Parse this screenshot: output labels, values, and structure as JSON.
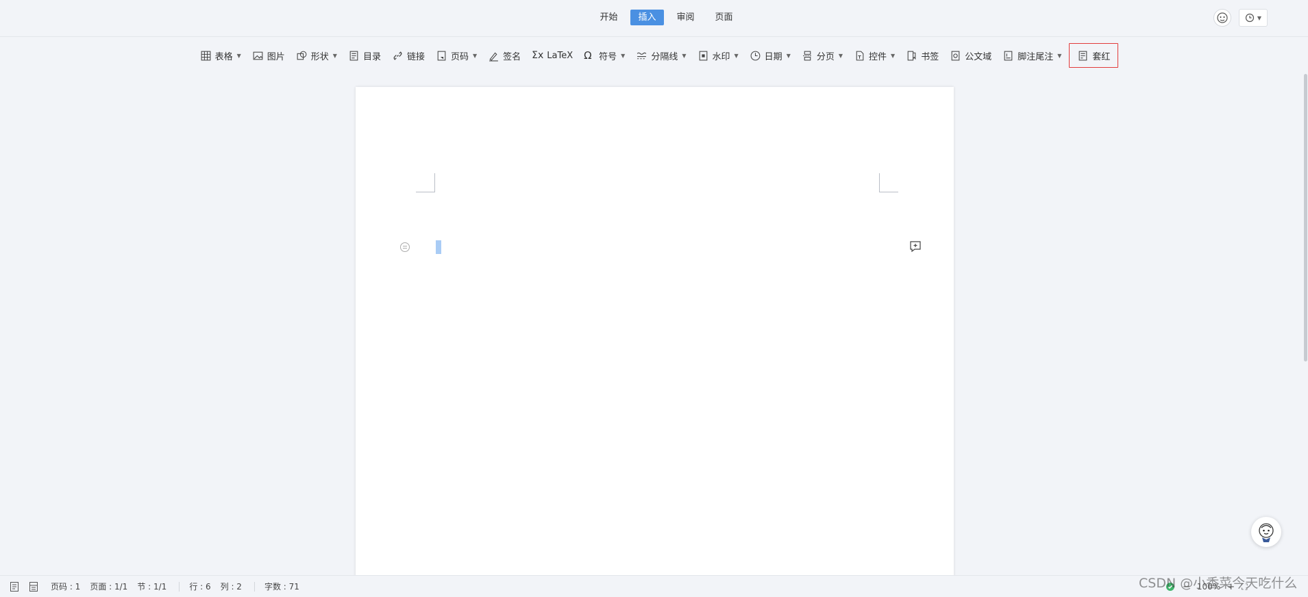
{
  "tabs": [
    {
      "label": "开始",
      "active": false
    },
    {
      "label": "插入",
      "active": true
    },
    {
      "label": "审阅",
      "active": false
    },
    {
      "label": "页面",
      "active": false
    }
  ],
  "colors": {
    "accent": "#4a90e2",
    "highlight_border": "#e23a3a",
    "selection": "#a9ccf5"
  },
  "ribbon": [
    {
      "label": "表格",
      "icon": "table-icon",
      "dropdown": true
    },
    {
      "label": "图片",
      "icon": "image-icon",
      "dropdown": false
    },
    {
      "label": "形状",
      "icon": "shape-icon",
      "dropdown": true
    },
    {
      "label": "目录",
      "icon": "toc-icon",
      "dropdown": false
    },
    {
      "label": "链接",
      "icon": "link-icon",
      "dropdown": false
    },
    {
      "label": "页码",
      "icon": "page-number-icon",
      "dropdown": true
    },
    {
      "label": "签名",
      "icon": "signature-icon",
      "dropdown": false
    },
    {
      "label": "LaTeX",
      "icon": "sigma-icon",
      "dropdown": false
    },
    {
      "label": "符号",
      "icon": "omega-icon",
      "dropdown": true
    },
    {
      "label": "分隔线",
      "icon": "divider-icon",
      "dropdown": true
    },
    {
      "label": "水印",
      "icon": "watermark-icon",
      "dropdown": true
    },
    {
      "label": "日期",
      "icon": "clock-icon",
      "dropdown": true
    },
    {
      "label": "分页",
      "icon": "page-break-icon",
      "dropdown": true
    },
    {
      "label": "控件",
      "icon": "control-icon",
      "dropdown": true
    },
    {
      "label": "书签",
      "icon": "bookmark-icon",
      "dropdown": false
    },
    {
      "label": "公文域",
      "icon": "official-field-icon",
      "dropdown": false
    },
    {
      "label": "脚注尾注",
      "icon": "footnote-icon",
      "dropdown": true
    },
    {
      "label": "套红",
      "icon": "red-header-icon",
      "dropdown": false,
      "highlighted": true
    }
  ],
  "status": {
    "page_code": "页码 : 1",
    "page": "页面 : 1/1",
    "section": "节 : 1/1",
    "row": "行 : 6",
    "col": "列 : 2",
    "word_count": "字数 : 71",
    "zoom": "100%"
  },
  "watermark": "CSDN @小香菜今天吃什么"
}
